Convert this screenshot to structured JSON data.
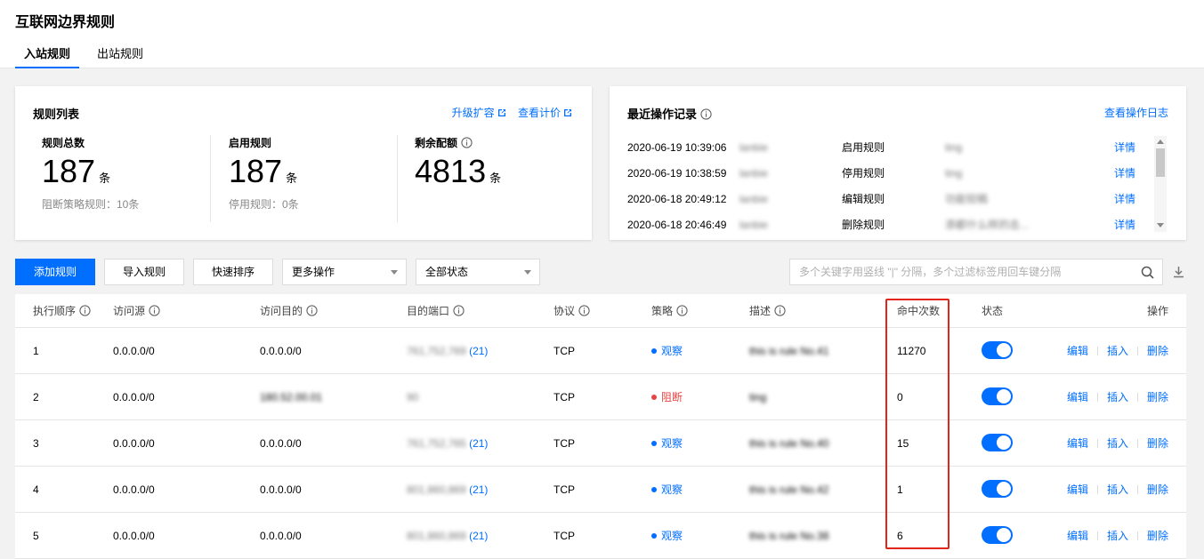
{
  "page": {
    "title": "互联网边界规则",
    "tabs": [
      "入站规则",
      "出站规则"
    ]
  },
  "rules_card": {
    "title": "规则列表",
    "upgrade_link": "升级扩容",
    "pricing_link": "查看计价",
    "stats": [
      {
        "label": "规则总数",
        "value": "187",
        "unit": "条",
        "sub": "阻断策略规则：10条"
      },
      {
        "label": "启用规则",
        "value": "187",
        "unit": "条",
        "sub": "停用规则：0条"
      },
      {
        "label": "剩余配额",
        "value": "4813",
        "unit": "条",
        "sub": ""
      }
    ]
  },
  "log_card": {
    "title": "最近操作记录",
    "view_log_link": "查看操作日志",
    "entries": [
      {
        "time": "2020-06-19 10:39:06",
        "user": "lanbie",
        "action": "启用规则",
        "target": "ting",
        "detail": "详情"
      },
      {
        "time": "2020-06-19 10:38:59",
        "user": "lanbie",
        "action": "停用规则",
        "target": "ting",
        "detail": "详情"
      },
      {
        "time": "2020-06-18 20:49:12",
        "user": "lanbie",
        "action": "编辑规则",
        "target": "功能较稿",
        "detail": "详情"
      },
      {
        "time": "2020-06-18 20:46:49",
        "user": "lanbie",
        "action": "删除规则",
        "target": "添都什么样的击...",
        "detail": "详情"
      }
    ]
  },
  "toolbar": {
    "add_rule": "添加规则",
    "import_rule": "导入规则",
    "quick_sort": "快速排序",
    "more_ops": "更多操作",
    "status_filter": "全部状态",
    "search_placeholder": "多个关键字用竖线 \"|\" 分隔，多个过滤标签用回车键分隔"
  },
  "table": {
    "headers": [
      "执行顺序",
      "访问源",
      "访问目的",
      "目的端口",
      "协议",
      "策略",
      "描述",
      "命中次数",
      "状态",
      "操作"
    ],
    "rows": [
      {
        "order": "1",
        "source": "0.0.0.0/0",
        "dest": "0.0.0.0/0",
        "port": "761,752,769",
        "port_count": "(21)",
        "protocol": "TCP",
        "policy": "观察",
        "policy_type": "observe",
        "desc": "this is rule No.41",
        "hits": "11270"
      },
      {
        "order": "2",
        "source": "0.0.0.0/0",
        "dest": "180.52.00.01",
        "port": "90",
        "port_count": "",
        "protocol": "TCP",
        "policy": "阻断",
        "policy_type": "block",
        "desc": "ting",
        "hits": "0"
      },
      {
        "order": "3",
        "source": "0.0.0.0/0",
        "dest": "0.0.0.0/0",
        "port": "761,752,765",
        "port_count": "(21)",
        "protocol": "TCP",
        "policy": "观察",
        "policy_type": "observe",
        "desc": "this is rule No.40",
        "hits": "15"
      },
      {
        "order": "4",
        "source": "0.0.0.0/0",
        "dest": "0.0.0.0/0",
        "port": "801,860,869",
        "port_count": "(21)",
        "protocol": "TCP",
        "policy": "观察",
        "policy_type": "observe",
        "desc": "this is rule No.42",
        "hits": "1"
      },
      {
        "order": "5",
        "source": "0.0.0.0/0",
        "dest": "0.0.0.0/0",
        "port": "801,860,869",
        "port_count": "(21)",
        "protocol": "TCP",
        "policy": "观察",
        "policy_type": "observe",
        "desc": "this is rule No.38",
        "hits": "6"
      }
    ],
    "row_ops": [
      "编辑",
      "插入",
      "删除"
    ]
  },
  "colors": {
    "accent": "#006eff",
    "observe": "#006eff",
    "block": "#e54545",
    "highlight_box": "#e1251b"
  }
}
